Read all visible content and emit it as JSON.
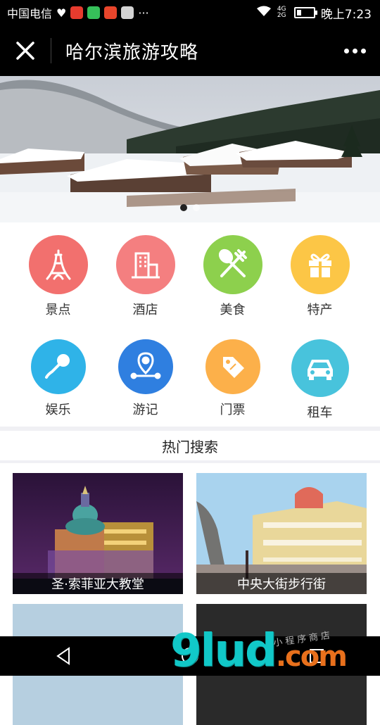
{
  "status_bar": {
    "carrier": "中国电信",
    "time": "晚上7:23",
    "network": "4G 2G"
  },
  "header": {
    "title": "哈尔滨旅游攻略"
  },
  "banner": {
    "slides": 2,
    "active_index": 0
  },
  "categories": [
    {
      "label": "景点",
      "icon": "tower-icon",
      "color": "#f2706e"
    },
    {
      "label": "酒店",
      "icon": "building-icon",
      "color": "#f47f80"
    },
    {
      "label": "美食",
      "icon": "fork-spoon-icon",
      "color": "#8dd04d"
    },
    {
      "label": "特产",
      "icon": "gift-icon",
      "color": "#fcc646"
    },
    {
      "label": "娱乐",
      "icon": "microphone-icon",
      "color": "#2fb3e8"
    },
    {
      "label": "游记",
      "icon": "map-pin-icon",
      "color": "#2f7fe0"
    },
    {
      "label": "门票",
      "icon": "ticket-tag-icon",
      "color": "#fcb04a"
    },
    {
      "label": "租车",
      "icon": "car-icon",
      "color": "#48c3dc"
    }
  ],
  "hot_search": {
    "title": "热门搜索",
    "cards": [
      {
        "caption": "圣·索菲亚大教堂"
      },
      {
        "caption": "中央大街步行街"
      },
      {
        "caption": ""
      },
      {
        "caption": ""
      }
    ]
  },
  "watermark": {
    "main": "9lud",
    "suffix": ".com",
    "small": "小程序商店"
  }
}
